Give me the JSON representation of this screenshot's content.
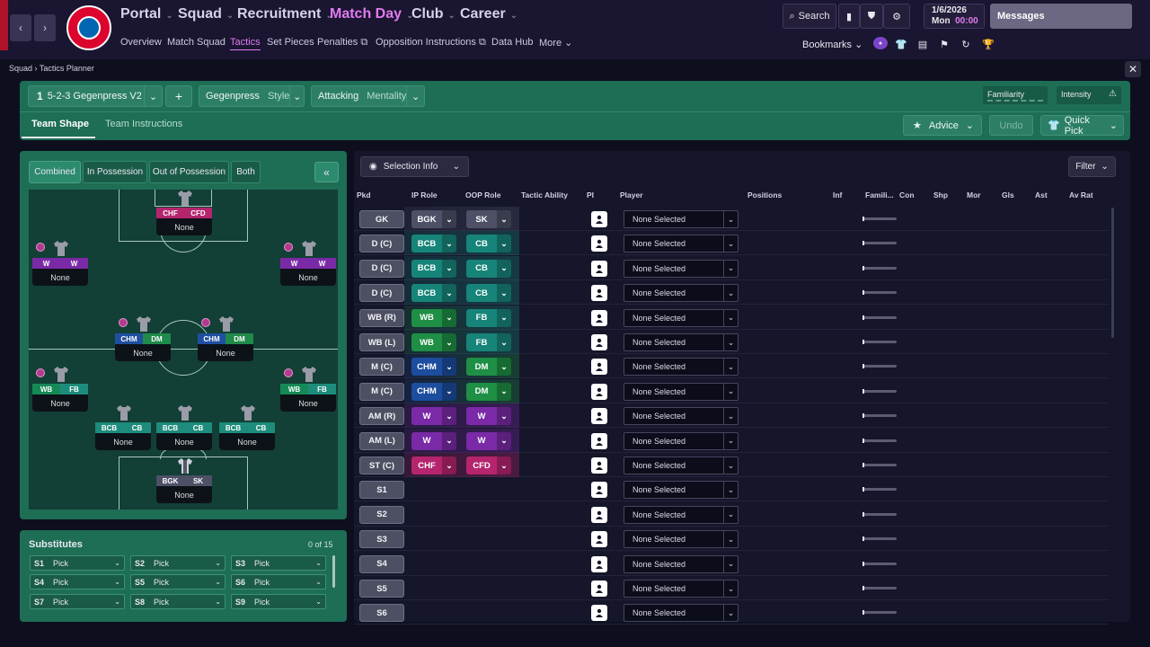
{
  "nav": {
    "back_icon": "chevron-left-icon",
    "forward_icon": "chevron-right-icon",
    "main": [
      "Portal",
      "Squad",
      "Recruitment",
      "Match Day",
      "Club",
      "Career"
    ],
    "sub": [
      "Overview",
      "Match Squad",
      "Tactics",
      "Set Pieces",
      "Penalties",
      "Opposition Instructions",
      "Data Hub",
      "More"
    ],
    "active_main": "Match Day",
    "active_sub": "Tactics",
    "search_label": "Search",
    "date": "1/6/2026",
    "day": "Mon",
    "time": "00:00",
    "messages_label": "Messages",
    "bookmarks_label": "Bookmarks"
  },
  "breadcrumb": [
    "Squad",
    "Tactics Planner"
  ],
  "tactic": {
    "slot_number": "1",
    "name": "5-2-3 Gegenpress V2",
    "add_label": "+",
    "style_value": "Gegenpress",
    "style_label": "Style",
    "mentality_value": "Attacking",
    "mentality_label": "Mentality",
    "familiarity_label": "Familiarity",
    "intensity_label": "Intensity",
    "tabs": [
      "Team Shape",
      "Team Instructions"
    ],
    "active_tab": "Team Shape",
    "advice_label": "Advice",
    "undo_label": "Undo",
    "quick_pick_label": "Quick Pick"
  },
  "pitch_view": {
    "tabs": [
      "Combined",
      "In Possession",
      "Out of Possession",
      "Both"
    ],
    "active_tab": "Combined",
    "collapse_label": "«",
    "players": [
      {
        "ip": "CHF",
        "oop": "CFD",
        "name": "None",
        "ip_color": "#b5256e",
        "oop_color": "#b5256e"
      },
      {
        "ip": "W",
        "oop": "W",
        "name": "None",
        "ip_color": "#7a2aa6",
        "oop_color": "#7a2aa6"
      },
      {
        "ip": "W",
        "oop": "W",
        "name": "None",
        "ip_color": "#7a2aa6",
        "oop_color": "#7a2aa6"
      },
      {
        "ip": "CHM",
        "oop": "DM",
        "name": "None",
        "ip_color": "#1f4fa0",
        "oop_color": "#1f8a4a"
      },
      {
        "ip": "CHM",
        "oop": "DM",
        "name": "None",
        "ip_color": "#1f4fa0",
        "oop_color": "#1f8a4a"
      },
      {
        "ip": "WB",
        "oop": "FB",
        "name": "None",
        "ip_color": "#168a56",
        "oop_color": "#1d8c7c"
      },
      {
        "ip": "WB",
        "oop": "FB",
        "name": "None",
        "ip_color": "#168a56",
        "oop_color": "#1d8c7c"
      },
      {
        "ip": "BCB",
        "oop": "CB",
        "name": "None",
        "ip_color": "#1d8c7c",
        "oop_color": "#1d8c7c"
      },
      {
        "ip": "BCB",
        "oop": "CB",
        "name": "None",
        "ip_color": "#1d8c7c",
        "oop_color": "#1d8c7c"
      },
      {
        "ip": "BCB",
        "oop": "CB",
        "name": "None",
        "ip_color": "#1d8c7c",
        "oop_color": "#1d8c7c"
      },
      {
        "ip": "BGK",
        "oop": "SK",
        "name": "None",
        "ip_color": "#4d5066",
        "oop_color": "#4d5066"
      }
    ]
  },
  "substitutes": {
    "title": "Substitutes",
    "count": "0 of 15",
    "slots": [
      {
        "id": "S1",
        "value": "Pick"
      },
      {
        "id": "S2",
        "value": "Pick"
      },
      {
        "id": "S3",
        "value": "Pick"
      },
      {
        "id": "S4",
        "value": "Pick"
      },
      {
        "id": "S5",
        "value": "Pick"
      },
      {
        "id": "S6",
        "value": "Pick"
      },
      {
        "id": "S7",
        "value": "Pick"
      },
      {
        "id": "S8",
        "value": "Pick"
      },
      {
        "id": "S9",
        "value": "Pick"
      }
    ]
  },
  "table": {
    "selection_info_label": "Selection Info",
    "filter_label": "Filter",
    "headers": [
      "Pkd",
      "IP Role",
      "OOP Role",
      "Tactic Ability",
      "PI",
      "Player",
      "Positions",
      "Inf",
      "Famili...",
      "Con",
      "Shp",
      "Mor",
      "Gls",
      "Ast",
      "Av Rat"
    ],
    "rows": [
      {
        "pos": "GK",
        "ip": "BGK",
        "oop": "SK",
        "player": "None Selected",
        "ip_color": "#4d5066",
        "oop_color": "#4d5066"
      },
      {
        "pos": "D (C)",
        "ip": "BCB",
        "oop": "CB",
        "player": "None Selected",
        "ip_color": "#17847a",
        "oop_color": "#17847a"
      },
      {
        "pos": "D (C)",
        "ip": "BCB",
        "oop": "CB",
        "player": "None Selected",
        "ip_color": "#17847a",
        "oop_color": "#17847a"
      },
      {
        "pos": "D (C)",
        "ip": "BCB",
        "oop": "CB",
        "player": "None Selected",
        "ip_color": "#17847a",
        "oop_color": "#17847a"
      },
      {
        "pos": "WB (R)",
        "ip": "WB",
        "oop": "FB",
        "player": "None Selected",
        "ip_color": "#1e8f45",
        "oop_color": "#17847a"
      },
      {
        "pos": "WB (L)",
        "ip": "WB",
        "oop": "FB",
        "player": "None Selected",
        "ip_color": "#1e8f45",
        "oop_color": "#17847a"
      },
      {
        "pos": "M (C)",
        "ip": "CHM",
        "oop": "DM",
        "player": "None Selected",
        "ip_color": "#1c4d9e",
        "oop_color": "#1e8f45"
      },
      {
        "pos": "M (C)",
        "ip": "CHM",
        "oop": "DM",
        "player": "None Selected",
        "ip_color": "#1c4d9e",
        "oop_color": "#1e8f45"
      },
      {
        "pos": "AM (R)",
        "ip": "W",
        "oop": "W",
        "player": "None Selected",
        "ip_color": "#7a2aa6",
        "oop_color": "#7a2aa6"
      },
      {
        "pos": "AM (L)",
        "ip": "W",
        "oop": "W",
        "player": "None Selected",
        "ip_color": "#7a2aa6",
        "oop_color": "#7a2aa6"
      },
      {
        "pos": "ST (C)",
        "ip": "CHF",
        "oop": "CFD",
        "player": "None Selected",
        "ip_color": "#b5256e",
        "oop_color": "#b5256e"
      },
      {
        "pos": "S1",
        "player": "None Selected"
      },
      {
        "pos": "S2",
        "player": "None Selected"
      },
      {
        "pos": "S3",
        "player": "None Selected"
      },
      {
        "pos": "S4",
        "player": "None Selected"
      },
      {
        "pos": "S5",
        "player": "None Selected"
      },
      {
        "pos": "S6",
        "player": "None Selected"
      }
    ]
  },
  "colors": {
    "accent": "#e07cf0",
    "panel_green": "#1e6d55",
    "pitch": "#123f36",
    "background": "#0d0f1f"
  }
}
